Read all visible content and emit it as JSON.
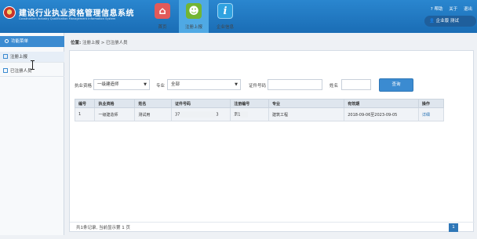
{
  "header": {
    "title": "建设行业执业资格管理信息系统",
    "subtitle": "Construction Industry Qualification Management Information System",
    "nav": [
      {
        "label": "首页"
      },
      {
        "label": "注册上报"
      },
      {
        "label": "企业信息"
      }
    ],
    "links": {
      "help": "帮助",
      "about": "关于",
      "logout": "退出"
    },
    "user": "企业版 测试"
  },
  "sidebar": {
    "title": "功能菜单",
    "items": [
      {
        "label": "注册上报"
      },
      {
        "label": "已注册人员"
      }
    ]
  },
  "breadcrumb": {
    "prefix": "位置:",
    "path": "注册上报 > 已注册人员"
  },
  "filters": {
    "qual_label": "执业资格",
    "qual_value": "一级建造师",
    "major_label": "专业",
    "major_value": "全部",
    "cert_label": "证件号码",
    "cert_value": "",
    "name_label": "姓名",
    "name_value": "",
    "search_button": "查询"
  },
  "table": {
    "headers": [
      "编号",
      "执业资格",
      "姓名",
      "证件号码",
      "注册编号",
      "专业",
      "有效期",
      "操作"
    ],
    "rows": [
      {
        "no": "1",
        "qual": "一级建造师",
        "name": "测试用",
        "cert_start": "37",
        "cert_end": "3",
        "reg_start": "京1",
        "major": "建筑工程",
        "valid": "2018-09-06至2023-09-05",
        "action": "详细"
      }
    ]
  },
  "pager": {
    "summary": "共1条记录, 当前显示第 1 页",
    "current": "1"
  }
}
